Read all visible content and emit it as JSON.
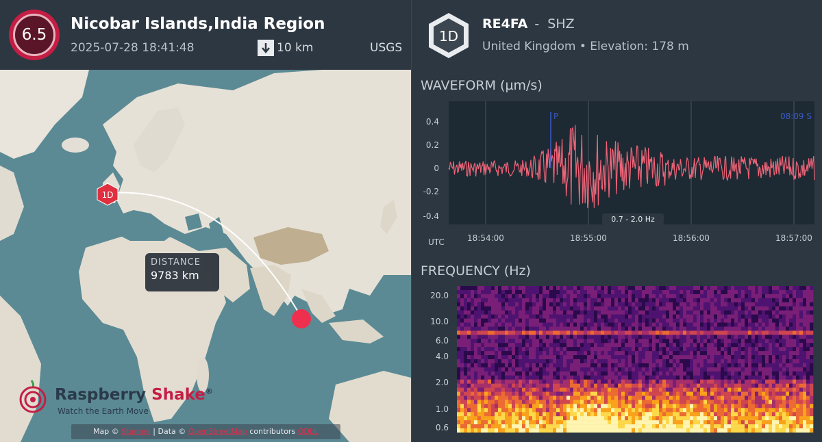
{
  "event": {
    "magnitude": "6.5",
    "title": "Nicobar Islands,India Region",
    "datetime": "2025-07-28 18:41:48",
    "depth": "10 km",
    "source": "USGS"
  },
  "map": {
    "station_marker": "1D",
    "distance_label": "DISTANCE",
    "distance_value": "9783 km",
    "attribution_prefix": "Map ©",
    "attribution_link1": "Stamen",
    "attribution_mid": "| Data ©",
    "attribution_link2": "OpenStreetMap",
    "attribution_suffix": "contributors",
    "attribution_link3": "ODbL"
  },
  "logo": {
    "brand_part1": "Raspberry",
    "brand_part2": "Shake",
    "registered": "®",
    "tagline": "Watch the Earth Move"
  },
  "station": {
    "badge": "1D",
    "code": "RE4FA",
    "separator": "-",
    "channel": "SHZ",
    "location": "United Kingdom • Elevation: 178 m"
  },
  "waveform": {
    "title": "WAVEFORM (µm/s)",
    "y_ticks": [
      "0.4",
      "0.2",
      "0",
      "-0.2",
      "-0.4"
    ],
    "x_ticks": [
      "18:54:00",
      "18:55:00",
      "18:56:00",
      "18:57:00"
    ],
    "x_unit": "UTC",
    "p_marker": "P",
    "s_marker": "08:09  S",
    "filter": "0.7 - 2.0 Hz",
    "colors": {
      "trace": "#f06478",
      "p_line": "#3a5ac8",
      "bg": "#1e2a33"
    }
  },
  "frequency": {
    "title": "FREQUENCY (Hz)",
    "y_ticks": [
      "20.0",
      "10.0",
      "6.0",
      "4.0",
      "2.0",
      "1.0",
      "0.6"
    ]
  },
  "colors": {
    "brand": "#c41e45",
    "panel": "#2d3741"
  }
}
